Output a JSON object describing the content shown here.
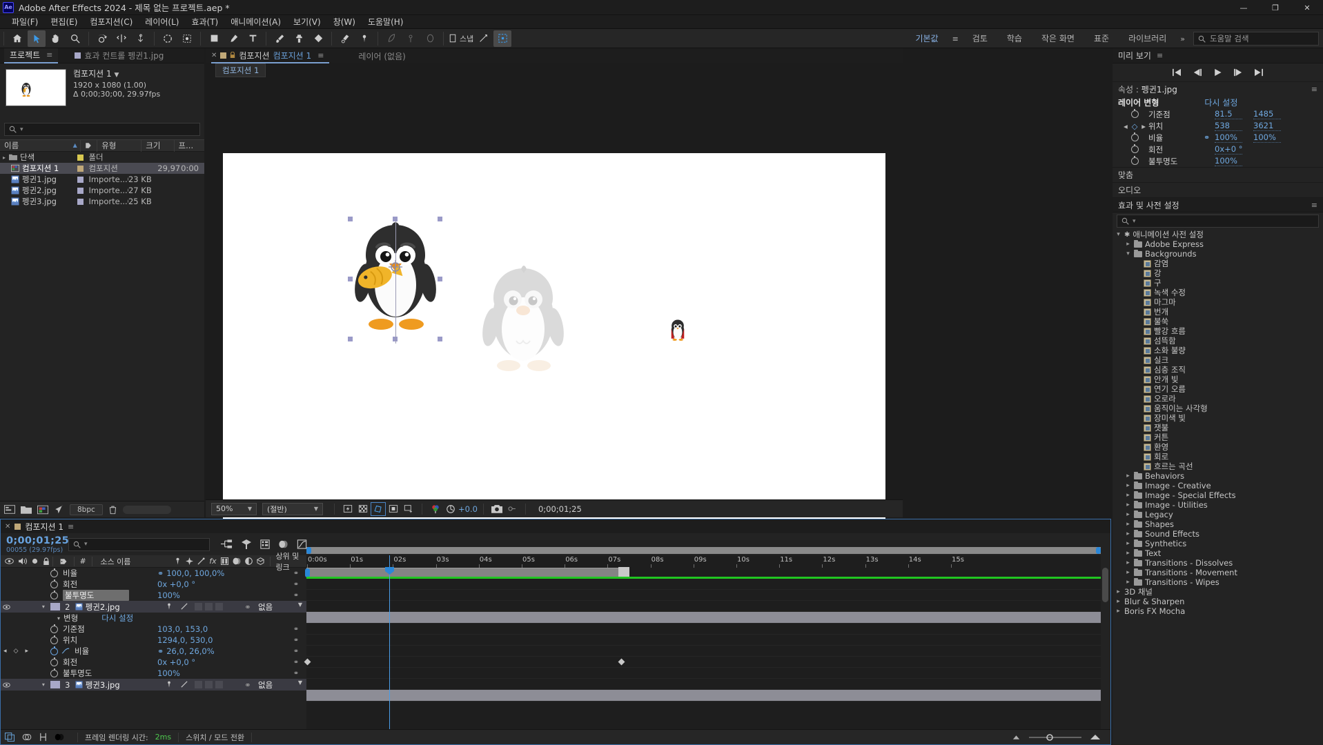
{
  "titlebar": {
    "app_badge": "Ae",
    "title": "Adobe After Effects 2024 - 제목 없는 프로젝트.aep *",
    "minimize": "—",
    "maximize": "❐",
    "close": "✕"
  },
  "menubar": {
    "items": [
      "파일(F)",
      "편집(E)",
      "컴포지션(C)",
      "레이어(L)",
      "효과(T)",
      "애니메이션(A)",
      "보기(V)",
      "창(W)",
      "도움말(H)"
    ]
  },
  "toolbar": {
    "snap_label": "스냅",
    "tools": [
      "home-icon",
      "selection-tool-icon",
      "hand-tool-icon",
      "zoom-tool-icon",
      "rotation-tool-icon",
      "unified-camera-tool-icon",
      "pan-behind-tool-icon",
      "roto-brush-tool-icon",
      "mask-tool-icon",
      "shape-tool-icon",
      "pen-tool-icon",
      "type-tool-icon",
      "brush-tool-icon",
      "clone-stamp-tool-icon",
      "eraser-tool-icon",
      "refine-edge-tool-icon",
      "puppet-pin-tool-icon"
    ]
  },
  "workspace": {
    "tabs": [
      "기본값",
      "검토",
      "학습",
      "작은 화면",
      "표준",
      "라이브러리"
    ],
    "active_tab": "기본값",
    "overflow": "»",
    "help_placeholder": "도움말 검색"
  },
  "project_panel": {
    "tabs": [
      {
        "label": "프로젝트",
        "active": true
      },
      {
        "label": "효과 컨트롤 펭귄1.jpg",
        "active": false
      }
    ],
    "selected_item": {
      "name": "컴포지션 1",
      "dimensions": "1920 x 1080 (1.00)",
      "duration": "Δ 0;00;30;00, 29.97fps"
    },
    "search_placeholder": "",
    "columns": [
      "이름",
      "유형",
      "크기",
      "프..."
    ],
    "sort_column": "이름",
    "rows": [
      {
        "name": "단색",
        "type": "폴더",
        "size": "",
        "duration": "",
        "swatch": "#d8c850",
        "icon": "folder-icon",
        "expandable": true,
        "selected": false
      },
      {
        "name": "컴포지션 1",
        "type": "컴포지션",
        "size": "",
        "duration": "29,97",
        "extra": "0:00",
        "swatch": "#c0a878",
        "icon": "composition-icon",
        "expandable": false,
        "selected": true
      },
      {
        "name": "펭귄1.jpg",
        "type": "Importe...G",
        "size": "23 KB",
        "duration": "",
        "swatch": "#a8a8c8",
        "icon": "image-icon",
        "expandable": false,
        "selected": false
      },
      {
        "name": "펭귄2.jpg",
        "type": "Importe...G",
        "size": "27 KB",
        "duration": "",
        "swatch": "#a8a8c8",
        "icon": "image-icon",
        "expandable": false,
        "selected": false
      },
      {
        "name": "펭귄3.jpg",
        "type": "Importe...G",
        "size": "25 KB",
        "duration": "",
        "swatch": "#a8a8c8",
        "icon": "image-icon",
        "expandable": false,
        "selected": false
      }
    ],
    "bottom": {
      "bit_depth": "8bpc"
    }
  },
  "comp_panel": {
    "tab_prefix": "컴포지션",
    "tab_name": "컴포지션 1",
    "layer_tab": "레이어 (없음)",
    "breadcrumb": "컴포지션 1",
    "bottom": {
      "zoom": "50%",
      "resolution": "(절반)",
      "exposure": "+0.0",
      "time": "0;00;01;25"
    }
  },
  "preview_panel": {
    "title": "미리 보기",
    "buttons": [
      "first-frame-icon",
      "prev-frame-icon",
      "play-icon",
      "next-frame-icon",
      "last-frame-icon"
    ]
  },
  "properties_panel": {
    "title_prefix": "속성 :",
    "title_layer": "펭귄1.jpg",
    "section_label": "레이어 변형",
    "reset_label": "다시 설정",
    "rows": [
      {
        "label": "기준점",
        "v1": "81.5",
        "v2": "1485",
        "link": false,
        "animated": false
      },
      {
        "label": "위치",
        "v1": "538",
        "v2": "3621",
        "link": false,
        "animated": true
      },
      {
        "label": "비율",
        "v1": "100%",
        "v2": "100%",
        "link": true,
        "animated": false
      },
      {
        "label": "회전",
        "v1": "0x+0 °",
        "v2": "",
        "link": false,
        "animated": false
      },
      {
        "label": "불투명도",
        "v1": "100%",
        "v2": "",
        "link": false,
        "animated": false
      }
    ]
  },
  "align_panel": {
    "title": "맞춤"
  },
  "audio_panel": {
    "title": "오디오"
  },
  "effects_panel": {
    "title": "효과 및 사전 설정",
    "search_placeholder": "",
    "tree": [
      {
        "label": "애니메이션 사전 설정",
        "depth": 0,
        "kind": "star",
        "expanded": true
      },
      {
        "label": "Adobe Express",
        "depth": 1,
        "kind": "folder",
        "expanded": false
      },
      {
        "label": "Backgrounds",
        "depth": 1,
        "kind": "folder",
        "expanded": true
      },
      {
        "label": "감염",
        "depth": 2,
        "kind": "preset"
      },
      {
        "label": "강",
        "depth": 2,
        "kind": "preset"
      },
      {
        "label": "구",
        "depth": 2,
        "kind": "preset"
      },
      {
        "label": "녹색 수정",
        "depth": 2,
        "kind": "preset"
      },
      {
        "label": "마그마",
        "depth": 2,
        "kind": "preset"
      },
      {
        "label": "번개",
        "depth": 2,
        "kind": "preset"
      },
      {
        "label": "불쑥",
        "depth": 2,
        "kind": "preset"
      },
      {
        "label": "빨강 흐름",
        "depth": 2,
        "kind": "preset"
      },
      {
        "label": "섬뜩함",
        "depth": 2,
        "kind": "preset"
      },
      {
        "label": "소화 불량",
        "depth": 2,
        "kind": "preset"
      },
      {
        "label": "실크",
        "depth": 2,
        "kind": "preset"
      },
      {
        "label": "심층 조직",
        "depth": 2,
        "kind": "preset"
      },
      {
        "label": "안개 빛",
        "depth": 2,
        "kind": "preset"
      },
      {
        "label": "연기 오름",
        "depth": 2,
        "kind": "preset"
      },
      {
        "label": "오로라",
        "depth": 2,
        "kind": "preset"
      },
      {
        "label": "움직이는 사각형",
        "depth": 2,
        "kind": "preset"
      },
      {
        "label": "장미색 빛",
        "depth": 2,
        "kind": "preset"
      },
      {
        "label": "잿불",
        "depth": 2,
        "kind": "preset"
      },
      {
        "label": "커튼",
        "depth": 2,
        "kind": "preset"
      },
      {
        "label": "환영",
        "depth": 2,
        "kind": "preset"
      },
      {
        "label": "회로",
        "depth": 2,
        "kind": "preset"
      },
      {
        "label": "흐르는 곡선",
        "depth": 2,
        "kind": "preset"
      },
      {
        "label": "Behaviors",
        "depth": 1,
        "kind": "folder",
        "expanded": false
      },
      {
        "label": "Image - Creative",
        "depth": 1,
        "kind": "folder",
        "expanded": false
      },
      {
        "label": "Image - Special Effects",
        "depth": 1,
        "kind": "folder",
        "expanded": false
      },
      {
        "label": "Image - Utilities",
        "depth": 1,
        "kind": "folder",
        "expanded": false
      },
      {
        "label": "Legacy",
        "depth": 1,
        "kind": "folder",
        "expanded": false
      },
      {
        "label": "Shapes",
        "depth": 1,
        "kind": "folder",
        "expanded": false
      },
      {
        "label": "Sound Effects",
        "depth": 1,
        "kind": "folder",
        "expanded": false
      },
      {
        "label": "Synthetics",
        "depth": 1,
        "kind": "folder",
        "expanded": false
      },
      {
        "label": "Text",
        "depth": 1,
        "kind": "folder",
        "expanded": false
      },
      {
        "label": "Transitions - Dissolves",
        "depth": 1,
        "kind": "folder",
        "expanded": false
      },
      {
        "label": "Transitions - Movement",
        "depth": 1,
        "kind": "folder",
        "expanded": false
      },
      {
        "label": "Transitions - Wipes",
        "depth": 1,
        "kind": "folder",
        "expanded": false
      },
      {
        "label": "3D 채널",
        "depth": 0,
        "kind": "plain",
        "expanded": false
      },
      {
        "label": "Blur & Sharpen",
        "depth": 0,
        "kind": "plain",
        "expanded": false
      },
      {
        "label": "Boris FX Mocha",
        "depth": 0,
        "kind": "plain",
        "expanded": false
      }
    ]
  },
  "timeline": {
    "tab_label": "컴포지션 1",
    "current_time": "0;00;01;25",
    "frame_info": "00055 (29.97fps)",
    "search_placeholder": "",
    "columns": {
      "source_name": "소스 이름",
      "parent_link": "상위 및 링크",
      "index": "#"
    },
    "ruler_ticks": [
      "0:00s",
      "01s",
      "02s",
      "03s",
      "04s",
      "05s",
      "06s",
      "07s",
      "08s",
      "09s",
      "10s",
      "11s",
      "12s",
      "13s",
      "14s",
      "15s"
    ],
    "rows": [
      {
        "kind": "prop",
        "indent": 3,
        "label": "비율",
        "value": "100,0, 100,0%",
        "link": true,
        "animated": false,
        "highlight": false
      },
      {
        "kind": "prop",
        "indent": 3,
        "label": "회전",
        "value": "0x +0,0 °",
        "link": false,
        "animated": false,
        "highlight": false
      },
      {
        "kind": "prop",
        "indent": 3,
        "label": "불투명도",
        "value": "100%",
        "link": false,
        "animated": false,
        "highlight": true
      },
      {
        "kind": "layer",
        "index": "2",
        "label": "펭귄2.jpg",
        "parent": "없음",
        "color": "#a8a8c8"
      },
      {
        "kind": "group",
        "indent": 2,
        "label": "변형",
        "value": "다시 설정"
      },
      {
        "kind": "prop",
        "indent": 3,
        "label": "기준점",
        "value": "103,0, 153,0",
        "link": false,
        "animated": false,
        "highlight": false
      },
      {
        "kind": "prop",
        "indent": 3,
        "label": "위치",
        "value": "1294,0, 530,0",
        "link": false,
        "animated": false,
        "highlight": false
      },
      {
        "kind": "prop",
        "indent": 3,
        "label": "비율",
        "value": "26,0, 26,0%",
        "link": true,
        "animated": true,
        "highlight": false,
        "nav": true
      },
      {
        "kind": "prop",
        "indent": 3,
        "label": "회전",
        "value": "0x +0,0 °",
        "link": false,
        "animated": false,
        "highlight": false
      },
      {
        "kind": "prop",
        "indent": 3,
        "label": "불투명도",
        "value": "100%",
        "link": false,
        "animated": false,
        "highlight": false
      },
      {
        "kind": "layer",
        "index": "3",
        "label": "펭귄3.jpg",
        "parent": "없음",
        "color": "#a8a8c8"
      }
    ],
    "bottom": {
      "render_label": "프레임 렌더링 시간:",
      "render_value": "2ms",
      "switches_label": "스위치 / 모드 전환"
    }
  },
  "colors": {
    "accent_blue": "#68a3e0",
    "work_area_green": "#21c521",
    "panel_bg": "#232323",
    "selection": "#4a4a52"
  }
}
